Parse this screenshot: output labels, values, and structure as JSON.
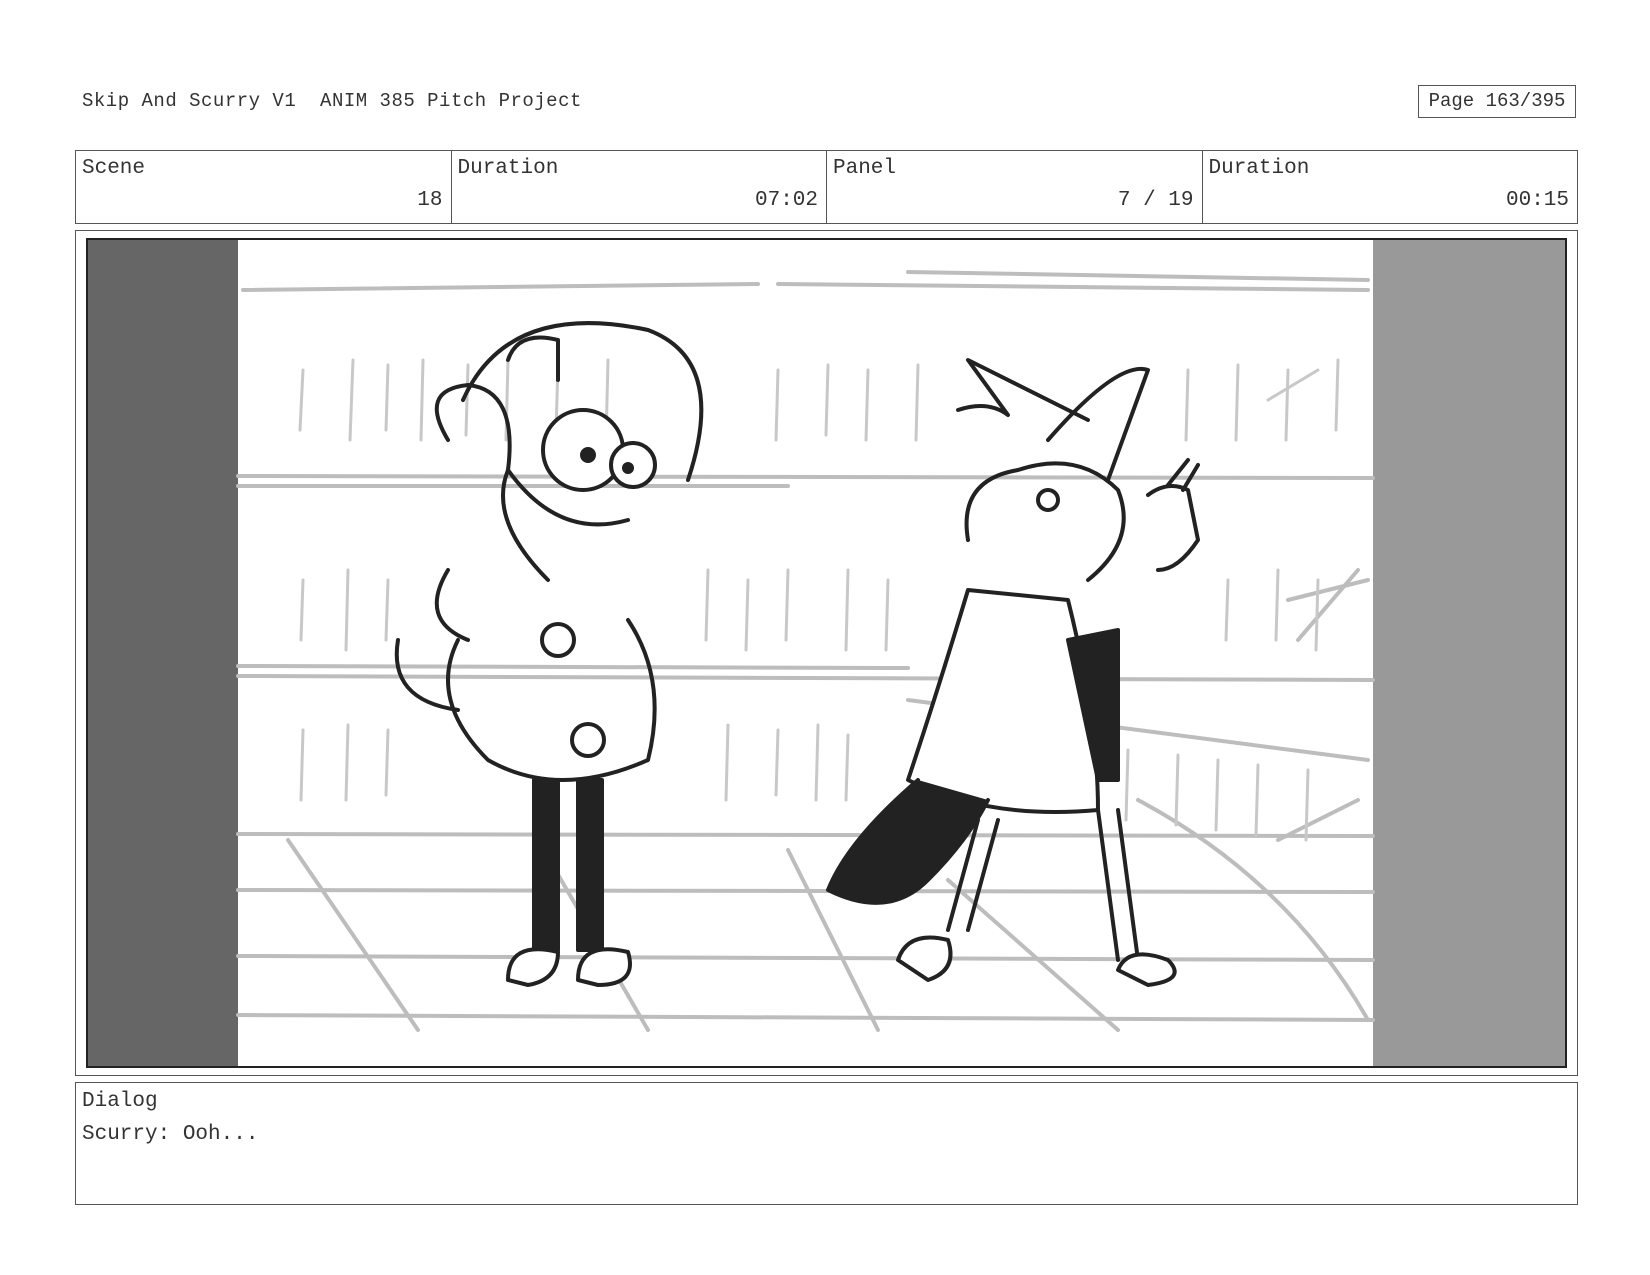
{
  "header": {
    "title": "Skip And Scurry V1  ANIM 385 Pitch Project",
    "page": "Page 163/395"
  },
  "info": {
    "scene_label": "Scene",
    "scene_value": "18",
    "duration_label": "Duration",
    "duration_value": "07:02",
    "panel_label": "Panel",
    "panel_value": "7 / 19",
    "panel_duration_label": "Duration",
    "panel_duration_value": "00:15"
  },
  "panel_image": {
    "description_icon": "storyboard-sketch",
    "letterbox_left_color": "#666666",
    "letterbox_right_color": "#999999"
  },
  "dialog": {
    "label": "Dialog",
    "text": "Scurry: Ooh..."
  }
}
